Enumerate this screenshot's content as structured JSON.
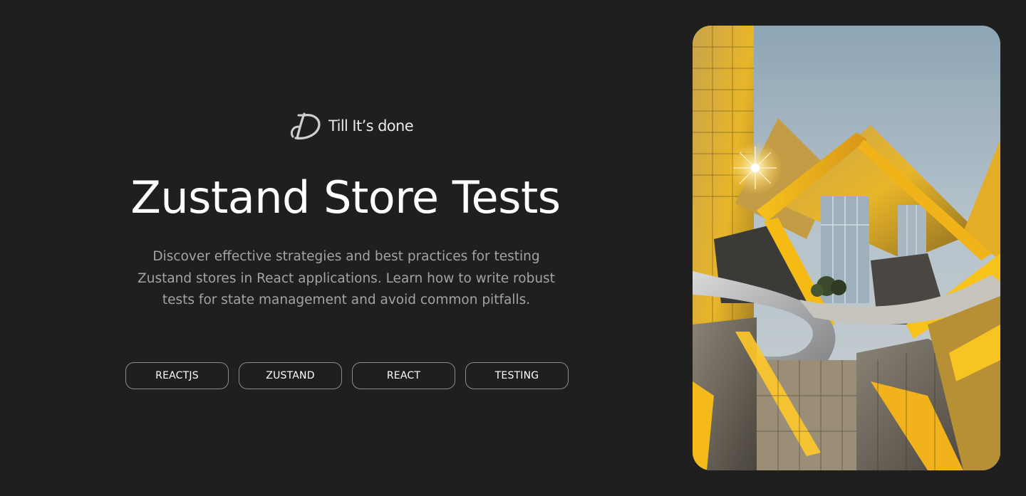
{
  "brand": {
    "name": "Till It’s done",
    "logo_icon": "td-monogram-icon"
  },
  "hero": {
    "title": "Zustand Store Tests",
    "description": "Discover effective strategies and best practices for testing Zustand stores in React applications. Learn how to write robust tests for state management and avoid common pitfalls.",
    "tags": [
      "REACTJS",
      "ZUSTAND",
      "REACT",
      "TESTING"
    ]
  },
  "image": {
    "subject": "golden-geometric-building-image"
  },
  "colors": {
    "background": "#1f1f1f",
    "title": "#ffffff",
    "description": "#a3a3a3",
    "tag_border": "#8a8a8a",
    "gold_accent": "#f2b90c",
    "sky": "#9fb2c0"
  }
}
